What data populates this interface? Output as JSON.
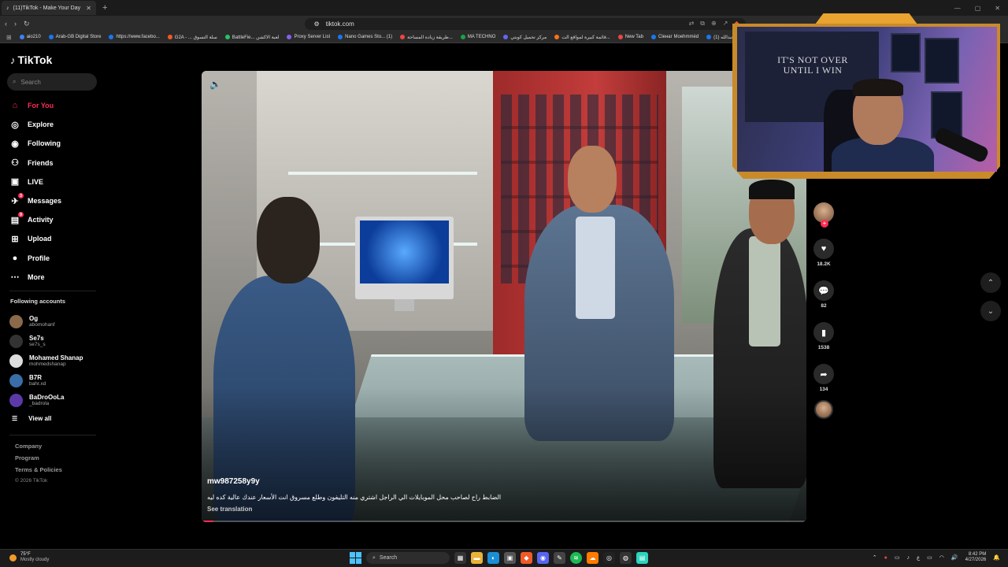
{
  "browser": {
    "tab_title": "(11)TikTok - Make Your Day",
    "url": "tiktok.com",
    "bookmarks": [
      {
        "label": "aio210",
        "color": "#3b82f6"
      },
      {
        "label": "Arab-GB Digital Store",
        "color": "#1877f2"
      },
      {
        "label": "https://www.facebo...",
        "color": "#1877f2"
      },
      {
        "label": "G2A - ... سلة التسوق",
        "color": "#f05a28"
      },
      {
        "label": "BattleFie... لعبة الاكشن",
        "color": "#22c55e"
      },
      {
        "label": "Proxy Server List",
        "color": "#8b5cf6"
      },
      {
        "label": "Nano Games Sto... (1)",
        "color": "#1877f2"
      },
      {
        "label": "طريقة زيادة المساحة...",
        "color": "#ef4444"
      },
      {
        "label": "MA TECHNO",
        "color": "#16a34a"
      },
      {
        "label": "مركز تحميل كوبتي",
        "color": "#6366f1"
      },
      {
        "label": "قائمة كبيرة لمواقع الت...",
        "color": "#f97316"
      },
      {
        "label": "New Tab",
        "color": "#ef4444"
      },
      {
        "label": "Cleнaг Moehmmèd",
        "color": "#1877f2"
      },
      {
        "label": "(1) عبدالله",
        "color": "#1877f2"
      }
    ]
  },
  "sidebar": {
    "logo": "TikTok",
    "search_placeholder": "Search",
    "nav": [
      {
        "label": "For You",
        "icon": "home-icon",
        "active": true
      },
      {
        "label": "Explore",
        "icon": "compass-icon"
      },
      {
        "label": "Following",
        "icon": "following-icon"
      },
      {
        "label": "Friends",
        "icon": "friends-icon"
      },
      {
        "label": "LIVE",
        "icon": "live-icon"
      },
      {
        "label": "Messages",
        "icon": "messages-icon",
        "badge": "3"
      },
      {
        "label": "Activity",
        "icon": "activity-icon",
        "badge": "9"
      },
      {
        "label": "Upload",
        "icon": "upload-icon"
      },
      {
        "label": "Profile",
        "icon": "profile-icon"
      },
      {
        "label": "More",
        "icon": "more-icon"
      }
    ],
    "following_title": "Following accounts",
    "accounts": [
      {
        "name": "Og",
        "handle": "abomohanf",
        "color": "#8a6a4a"
      },
      {
        "name": "Se7s",
        "handle": "se7s_s",
        "color": "#333"
      },
      {
        "name": "Mohamed Shanap",
        "handle": "mohmedshanap",
        "color": "#ddd"
      },
      {
        "name": "B7R",
        "handle": "bahr.xd",
        "color": "#3a6ea8"
      },
      {
        "name": "BaDroOoLa",
        "handle": "_badrola",
        "color": "#5b3aa8"
      }
    ],
    "view_all": "View all",
    "footer": [
      "Company",
      "Program",
      "Terms & Policies"
    ],
    "copyright": "© 2026 TikTok"
  },
  "video": {
    "author": "mw987258y9y",
    "description": "الضابط راح لصاحب محل الموبايلات الي الراجل اشتري منه التليفون وطلع مسروق انت الأسعار عندك عالية كده ليه",
    "translate": "See translation",
    "progress": 0.02
  },
  "actions": {
    "likes": "18.2K",
    "comments": "82",
    "saves": "1538",
    "shares": "134"
  },
  "webcam": {
    "flag_text": "IT'S NOT OVER UNTIL I WIN"
  },
  "taskbar": {
    "temp": "75°F",
    "weather": "Mostly cloudy",
    "search": "Search",
    "time": "8:42 PM",
    "date": "4/27/2026"
  }
}
